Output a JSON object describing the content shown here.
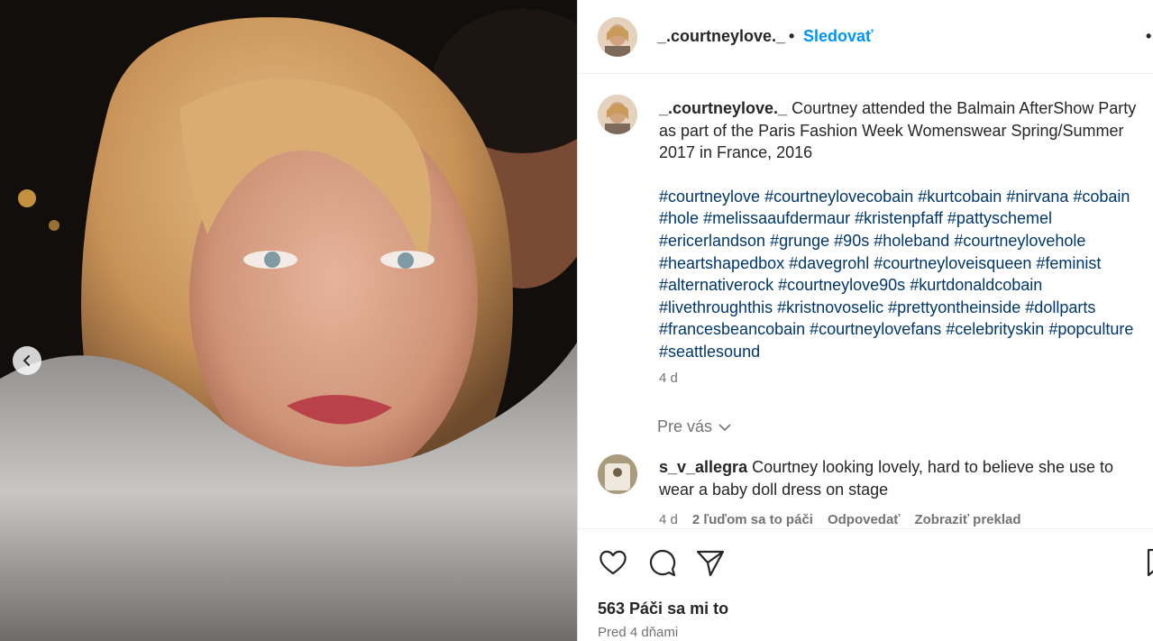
{
  "post": {
    "username": "_.courtneylove._",
    "dot": "•",
    "follow_label": "Sledovať",
    "more_label": "•",
    "caption_text": "Courtney attended the Balmain AfterShow Party as part of the Paris Fashion Week Womenswear Spring/Summer 2017 in France, 2016",
    "hashtags": [
      "#courtneylove",
      "#courtneylovecobain",
      "#kurtcobain",
      "#nirvana",
      "#cobain",
      "#hole",
      "#melissaaufdermaur",
      "#kristenpfaff",
      "#pattyschemel",
      "#ericerlandson",
      "#grunge",
      "#90s",
      "#holeband",
      "#courtneylovehole",
      "#heartshapedbox",
      "#davegrohl",
      "#courtneyloveisqueen",
      "#feminist",
      "#alternativerock",
      "#courtneylove90s",
      "#kurtdonaldcobain",
      "#livethroughthis",
      "#kristnovoselic",
      "#prettyontheinside",
      "#dollparts",
      "#francesbeancobain",
      "#courtneylovefans",
      "#celebrityskin",
      "#popculture",
      "#seattlesound"
    ],
    "caption_time": "4 d",
    "for_you_label": "Pre vás"
  },
  "comment": {
    "username": "s_v_allegra",
    "text": "Courtney looking lovely, hard to believe she use to wear a baby doll dress on stage",
    "time": "4 d",
    "likes": "2 ľuďom sa to páči",
    "reply": "Odpovedať",
    "translate": "Zobraziť preklad"
  },
  "footer": {
    "likes_label": "563 Páči sa mi to",
    "date_label": "Pred 4 dňami"
  },
  "icons": [
    "heart-icon",
    "comment-icon",
    "share-icon",
    "bookmark-icon",
    "chevron-left-icon",
    "chevron-down-icon"
  ],
  "colors": {
    "link": "#00376b",
    "follow": "#0095f6",
    "muted": "#737373"
  }
}
